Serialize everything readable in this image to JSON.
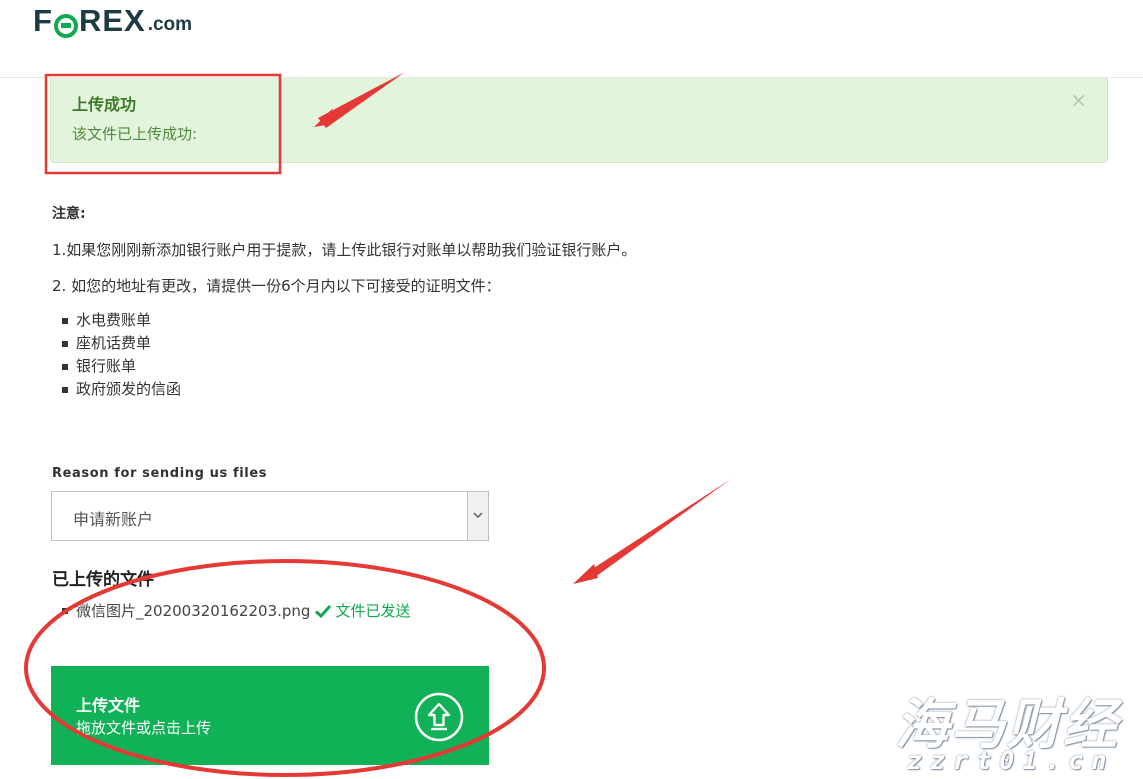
{
  "brand": {
    "logo_pre": "F",
    "logo_post": "REX",
    "logo_domain": ".com"
  },
  "alert": {
    "title": "上传成功",
    "message": "该文件已上传成功:",
    "close": "×"
  },
  "notice": {
    "heading": "注意:",
    "p1": "1.如果您刚刚新添加银行账户用于提款，请上传此银行对账单以帮助我们验证银行账户。",
    "p2": "2. 如您的地址有更改，请提供一份6个月内以下可接受的证明文件：",
    "items": [
      "水电费账单",
      "座机话费单",
      "银行账单",
      "政府颁发的信函"
    ]
  },
  "reason": {
    "label": "Reason for sending us files",
    "selected": "申请新账户"
  },
  "uploaded": {
    "title": "已上传的文件",
    "files": [
      {
        "name": "微信图片_20200320162203.png",
        "status": "文件已发送"
      }
    ]
  },
  "upload": {
    "title": "上传文件",
    "subtitle": "拖放文件或点击上传"
  },
  "watermark": {
    "text": "海马财经",
    "url": "zzrt01.cn"
  },
  "colors": {
    "brand_green": "#10b157",
    "brand_dark": "#1e3a45",
    "alert_bg": "#e3f4dc",
    "annotation_red": "#e53935"
  }
}
